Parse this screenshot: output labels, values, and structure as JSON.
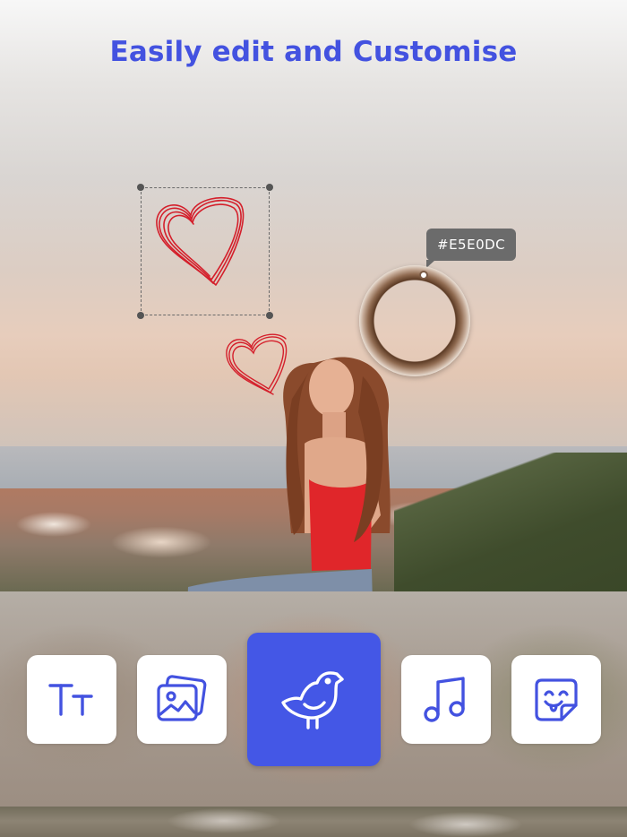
{
  "header": {
    "title": "Easily edit and Customise"
  },
  "canvas": {
    "selected_sticker": "heart-sticker",
    "color_picker": {
      "value_label": "#E5E0DC"
    }
  },
  "toolbar": {
    "items": [
      {
        "name": "text-tool",
        "icon": "text-size-icon",
        "selected": false
      },
      {
        "name": "image-tool",
        "icon": "photos-icon",
        "selected": false
      },
      {
        "name": "sticker-tool",
        "icon": "bird-icon",
        "selected": true
      },
      {
        "name": "music-tool",
        "icon": "music-note-icon",
        "selected": false
      },
      {
        "name": "emoji-tool",
        "icon": "emoji-sticker-icon",
        "selected": false
      }
    ]
  },
  "colors": {
    "accent": "#4457E6",
    "title": "#4352E0",
    "heart": "#D41F2B",
    "tooltip_bg": "#6B6B6B"
  }
}
